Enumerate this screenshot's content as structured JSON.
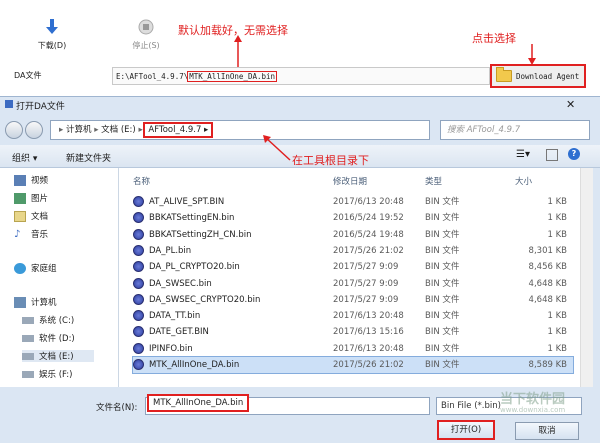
{
  "app": {
    "download_label": "下载(D)",
    "stop_label": "停止(S)",
    "da_file_label": "DA文件",
    "da_path_prefix": "E:\\AFTool_4.9.7\\",
    "da_path_file": "MTK_AllInOne_DA.bin",
    "download_agent_label": "Download Agent",
    "annotation_loaded": "默认加载好，无需选择",
    "annotation_click": "点击选择"
  },
  "dialog": {
    "title": "打开DA文件",
    "breadcrumb": [
      "计算机",
      "文档 (E:)",
      "AFTool_4.9.7"
    ],
    "search_placeholder": "搜索 AFTool_4.9.7",
    "organize_label": "组织 ▾",
    "new_folder_label": "新建文件夹",
    "annotation_root": "在工具根目录下",
    "sidebar": [
      {
        "label": "视频",
        "color": "#5a7fb5"
      },
      {
        "label": "图片",
        "color": "#4f9a6a"
      },
      {
        "label": "文档",
        "color": "#e8d68a"
      },
      {
        "label": "音乐",
        "color": "#3c6bc2"
      },
      {
        "label": "家庭组",
        "color": "#3a9ad9"
      },
      {
        "label": "计算机",
        "color": "#6a8db5"
      },
      {
        "label": "系统 (C:)",
        "color": "#9aa8b8"
      },
      {
        "label": "软件 (D:)",
        "color": "#9aa8b8"
      },
      {
        "label": "文档 (E:)",
        "color": "#9aa8b8"
      },
      {
        "label": "娱乐 (F:)",
        "color": "#9aa8b8"
      }
    ],
    "columns": {
      "name": "名称",
      "date": "修改日期",
      "type": "类型",
      "size": "大小"
    },
    "files": [
      {
        "name": "AT_ALIVE_SPT.BIN",
        "date": "2017/6/13 20:48",
        "type": "BIN 文件",
        "size": "1 KB"
      },
      {
        "name": "BBKATSettingEN.bin",
        "date": "2016/5/24 19:52",
        "type": "BIN 文件",
        "size": "1 KB"
      },
      {
        "name": "BBKATSettingZH_CN.bin",
        "date": "2016/5/24 19:48",
        "type": "BIN 文件",
        "size": "1 KB"
      },
      {
        "name": "DA_PL.bin",
        "date": "2017/5/26 21:02",
        "type": "BIN 文件",
        "size": "8,301 KB"
      },
      {
        "name": "DA_PL_CRYPTO20.bin",
        "date": "2017/5/27 9:09",
        "type": "BIN 文件",
        "size": "8,456 KB"
      },
      {
        "name": "DA_SWSEC.bin",
        "date": "2017/5/27 9:09",
        "type": "BIN 文件",
        "size": "4,648 KB"
      },
      {
        "name": "DA_SWSEC_CRYPTO20.bin",
        "date": "2017/5/27 9:09",
        "type": "BIN 文件",
        "size": "4,648 KB"
      },
      {
        "name": "DATA_TT.bin",
        "date": "2017/6/13 20:48",
        "type": "BIN 文件",
        "size": "1 KB"
      },
      {
        "name": "DATE_GET.BIN",
        "date": "2017/6/13 15:16",
        "type": "BIN 文件",
        "size": "1 KB"
      },
      {
        "name": "IPINFO.bin",
        "date": "2017/6/13 20:48",
        "type": "BIN 文件",
        "size": "1 KB"
      },
      {
        "name": "MTK_AllInOne_DA.bin",
        "date": "2017/5/26 21:02",
        "type": "BIN 文件",
        "size": "8,589 KB",
        "selected": true
      }
    ],
    "filename_label": "文件名(N):",
    "filename_value": "MTK_AllInOne_DA.bin",
    "filetype_value": "Bin File (*.bin)",
    "open_label": "打开(O)",
    "cancel_label": "取消"
  },
  "watermark": {
    "text": "当下软件园",
    "sub": "www.downxia.com"
  },
  "colors": {
    "accent_red": "#e02020",
    "dialog_bg": "#dbe6f3",
    "selection": "#cce0f7"
  }
}
